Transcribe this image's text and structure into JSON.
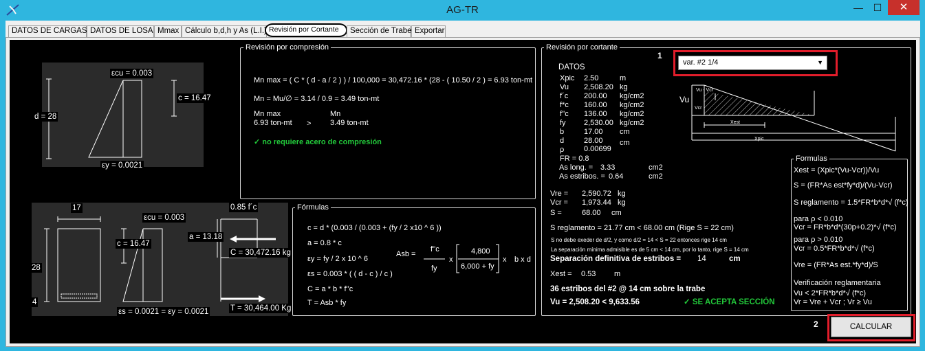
{
  "window": {
    "title": "AG-TR",
    "min_glyph": "—",
    "max_glyph": "☐",
    "close_glyph": "✕"
  },
  "tabs": [
    {
      "label": "DATOS DE CARGAS"
    },
    {
      "label": "DATOS DE LOSA"
    },
    {
      "label": "Mmax"
    },
    {
      "label": "Cálculo b,d,h y As (L.I.)"
    },
    {
      "label": "Revisión por Cortante",
      "active": true
    },
    {
      "label": "Sección de Trabe"
    },
    {
      "label": "Exportar"
    }
  ],
  "diagram1": {
    "ecu": "εcu = 0.003",
    "c": "c = 16.47",
    "d": "d = 28",
    "ey": "εy = 0.0021"
  },
  "diagram2": {
    "b": "17",
    "ecu": "εcu = 0.003",
    "fc": "0.85  f´c",
    "c": "c = 16.47",
    "a": "a = 13.18",
    "C": "C = 30,472.16 kg",
    "h": "28",
    "rec": "4",
    "es": "εs = 0.0021  =   εy = 0.0021",
    "T": "T = 30,464.00 Kg"
  },
  "compresion": {
    "title": "Revisión por compresión",
    "line1": "Mn max = ( C * ( d - a / 2 ) ) / 100,000 = 30,472.16 * (28 - ( 10.50 / 2 ) = 6.93 ton-mt",
    "line2": "Mn = Mu/∅ = 3.14 / 0.9 = 3.49 ton-mt",
    "h1": "Mn max",
    "h2": "Mn",
    "v1": "6.93 ton-mt",
    "op": ">",
    "v2": "3.49 ton-mt",
    "result": "✓   no requiere acero de compresión"
  },
  "formulas": {
    "title": "Fórmulas",
    "lines": [
      "c = d * (0.003 / (0.003 + (fy / 2 x10 ^ 6 ))",
      "a = 0.8 * c",
      "εy = fy / 2 x 10 ^ 6",
      "εs = 0.003 * ( ( d - c ) / c )",
      "C = a * b * f''c",
      "T = Asb * fy"
    ],
    "asb": "Asb =",
    "fcc": "f''c",
    "fy": "fy",
    "x1": "x",
    "n4800": "4,800",
    "den": "6,000 + fy",
    "x2": "x",
    "bxd": "b x d"
  },
  "cortante": {
    "title": "Revisión por cortante",
    "datos_title": "DATOS",
    "datos": [
      {
        "k": "Xpic",
        "v": "2.50",
        "u": "m"
      },
      {
        "k": "Vu",
        "v": "2,508.20",
        "u": "kg"
      },
      {
        "k": "f´c",
        "v": "200.00",
        "u": "kg/cm2"
      },
      {
        "k": "f*c",
        "v": "160.00",
        "u": "kg/cm2"
      },
      {
        "k": "f''c",
        "v": "136.00",
        "u": "kg/cm2"
      },
      {
        "k": "fy",
        "v": "2,530.00",
        "u": "kg/cm2"
      },
      {
        "k": "b",
        "v": "17.00",
        "u": "cm"
      },
      {
        "k": "d",
        "v": "28.00",
        "u": "cm"
      },
      {
        "k": "ρ",
        "v": "0.00699",
        "u": ""
      }
    ],
    "fr": "FR =    0.8",
    "as_long_k": "As long. =",
    "as_long_v": "3.33",
    "as_long_u": "cm2",
    "as_est_k": "As estribos. =",
    "as_est_v": "0.64",
    "as_est_u": "cm2",
    "vre_k": "Vre =",
    "vre_v": "2,590.72",
    "vre_u": "kg",
    "vcr_k": "Vcr =",
    "vcr_v": "1,973.44",
    "vcr_u": "kg",
    "s_k": "S =",
    "s_v": "68.00",
    "s_u": "cm",
    "s_reg": "S reglamento =  21.77  cm   <   68.00 cm    (Rige S =  22 cm)",
    "note1": "S no debe exeder de d/2, y como d/2 = 14 <  S = 22 entonces rige 14 cm",
    "note2": "La separación mínima admisible es de 5 cm < 14 cm, por lo tanto, rige S = 14 cm",
    "sep_k": "Separación definitiva de estribos =",
    "sep_v": "14",
    "sep_u": "cm",
    "xest_k": "Xest =",
    "xest_v": "0.53",
    "xest_u": "m",
    "estribos": "36 estribos del #2 @ 14 cm sobre la trabe",
    "vu_cmp": "Vu = 2,508.20  <  9,633.56",
    "acepta": "✓ SE ACEPTA SECCIÓN"
  },
  "diagram3": {
    "vu": "Vu",
    "vuvcr": "Vu - Vcr",
    "vcr": "Vcr",
    "xest": "Xest",
    "xpic": "Xpic"
  },
  "select": {
    "value": "var. #2 1/4"
  },
  "formulas2": {
    "title": "Formulas",
    "lines": [
      "Xest = (Xpic*(Vu-Vcr))/Vu",
      "S = (FR*As est*fy*d)/(Vu-Vcr)",
      "S reglamento = 1.5*FR*b*d*√ (f*c)",
      "   para ρ  < 0.010",
      "Vcr = FR*b*d*(30p+0.2)*√ (f*c)",
      "   para ρ  > 0.010",
      "Vcr = 0.5*FR*b*d*√ (f*c)",
      "Vre = (FR*As est.*fy*d)/S",
      "Verificación reglamentaria",
      "Vu < 2*FR*b*d*√ (f*c)",
      "Vr = Vre + Vcr ; Vr ≥ Vu"
    ]
  },
  "annotations": {
    "n1": "1",
    "n2": "2"
  },
  "calcular": "CALCULAR"
}
